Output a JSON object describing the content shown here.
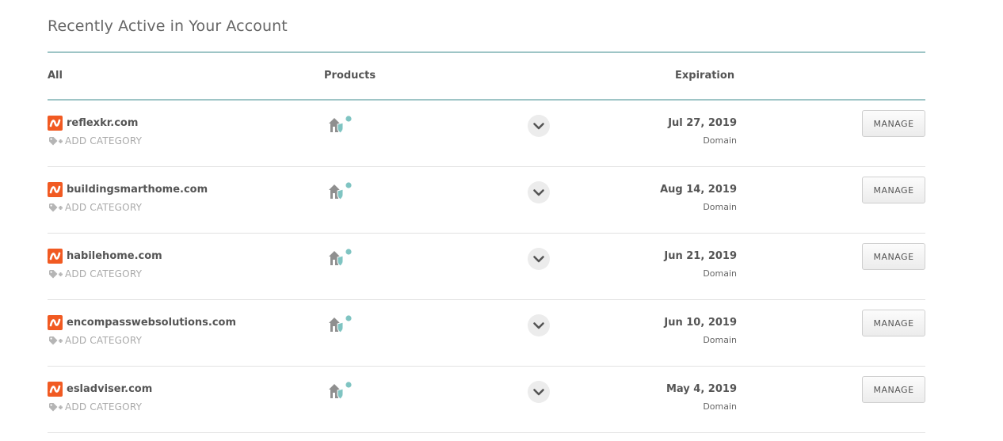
{
  "page": {
    "title": "Recently Active in Your Account"
  },
  "table": {
    "headers": {
      "all": "All",
      "products": "Products",
      "expiration": "Expiration"
    },
    "rows": [
      {
        "domain": "reflexkr.com",
        "add_category": "ADD CATEGORY",
        "expiration": "Jul 27, 2019",
        "type": "Domain",
        "manage": "MANAGE"
      },
      {
        "domain": "buildingsmarthome.com",
        "add_category": "ADD CATEGORY",
        "expiration": "Aug 14, 2019",
        "type": "Domain",
        "manage": "MANAGE"
      },
      {
        "domain": "habilehome.com",
        "add_category": "ADD CATEGORY",
        "expiration": "Jun 21, 2019",
        "type": "Domain",
        "manage": "MANAGE"
      },
      {
        "domain": "encompasswebsolutions.com",
        "add_category": "ADD CATEGORY",
        "expiration": "Jun 10, 2019",
        "type": "Domain",
        "manage": "MANAGE"
      },
      {
        "domain": "esladviser.com",
        "add_category": "ADD CATEGORY",
        "expiration": "May 4, 2019",
        "type": "Domain",
        "manage": "MANAGE"
      }
    ]
  },
  "icons": {
    "logo": "namecheap-logo-icon",
    "tag": "tag-icon",
    "product": "home-shield-icon",
    "chevron": "chevron-down-icon"
  },
  "colors": {
    "accent_line": "#9ec5c6",
    "logo_orange": "#f15a22",
    "product_teal": "#7fc4c2",
    "text_dark": "#555555",
    "text_muted": "#aaaaaa"
  }
}
